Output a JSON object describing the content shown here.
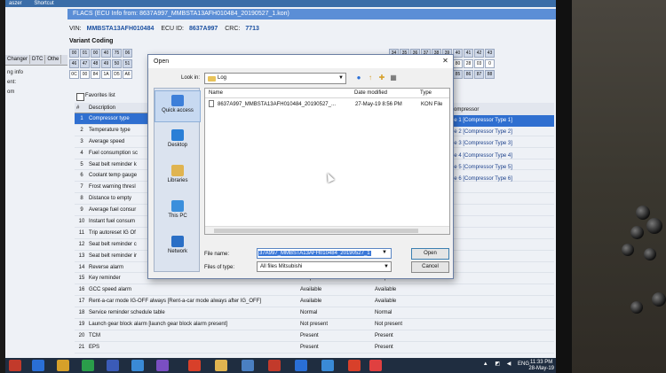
{
  "desktop": {
    "top_items": [
      "aszer",
      "Shortcut"
    ]
  },
  "bg_app": {
    "title": "FLACS (ECU Info from: 8637A997_MMBSTA13AFH010484_20190527_1.kon)",
    "vin_label": "VIN:",
    "vin": "MMBSTA13AFH010484",
    "ecu_label": "ECU ID:",
    "ecu": "8637A997",
    "crc_label": "CRC:",
    "crc": "7713",
    "variant_label": "Variant Coding",
    "left_tabs": [
      "Changer",
      "DTC",
      "Othe"
    ],
    "left_info": [
      "ng info",
      "ent:",
      "om"
    ],
    "hex_row1": [
      "00",
      "01",
      "00",
      "40",
      "75",
      "06"
    ],
    "hex_row2": [
      "46",
      "47",
      "48",
      "49",
      "50",
      "51"
    ],
    "hex_row3": [
      "0C",
      "00",
      "84",
      "1A",
      "D5",
      "A6"
    ],
    "hex_right1": [
      "34",
      "35",
      "36",
      "37",
      "38",
      "39",
      "40",
      "41",
      "42",
      "43"
    ],
    "hex_right2": [
      "43",
      "0C",
      "04",
      "80",
      "00",
      "00",
      "80",
      "28",
      "03",
      "0"
    ],
    "hex_right3": [
      "75",
      "80",
      "81",
      "82",
      "83",
      "84",
      "85",
      "86",
      "87",
      "88"
    ],
    "favorites_label": "Favorites list",
    "col_num": "#",
    "col_desc": "Description",
    "rows": [
      {
        "n": "1",
        "desc": "Compressor type",
        "a": "",
        "b": ""
      },
      {
        "n": "2",
        "desc": "Temperature type",
        "a": "",
        "b": ""
      },
      {
        "n": "3",
        "desc": "Average speed",
        "a": "",
        "b": ""
      },
      {
        "n": "4",
        "desc": "Fuel consumption sc",
        "a": "",
        "b": ""
      },
      {
        "n": "5",
        "desc": "Seat belt reminder k",
        "a": "",
        "b": ""
      },
      {
        "n": "6",
        "desc": "Coolant temp gauge",
        "a": "",
        "b": ""
      },
      {
        "n": "7",
        "desc": "Frost warning thresl",
        "a": "",
        "b": ""
      },
      {
        "n": "8",
        "desc": "Distance to empty",
        "a": "",
        "b": ""
      },
      {
        "n": "9",
        "desc": "Average fuel consur",
        "a": "",
        "b": ""
      },
      {
        "n": "10",
        "desc": "Instant fuel consum",
        "a": "",
        "b": ""
      },
      {
        "n": "11",
        "desc": "Trip autoreset IG Of",
        "a": "",
        "b": ""
      },
      {
        "n": "12",
        "desc": "Seat belt reminder c",
        "a": "",
        "b": ""
      },
      {
        "n": "13",
        "desc": "Seat belt reminder ir",
        "a": "",
        "b": ""
      },
      {
        "n": "14",
        "desc": "Reverse alarm",
        "a": "",
        "b": ""
      },
      {
        "n": "15",
        "desc": "Key reminder",
        "a": "Not present",
        "b": "Not present"
      },
      {
        "n": "16",
        "desc": "GCC speed alarm",
        "a": "Available",
        "b": "Available"
      },
      {
        "n": "17",
        "desc": "Rent-a-car mode IG-OFF always  [Rent-a-car mode always after IG_OFF]",
        "a": "Available",
        "b": "Available"
      },
      {
        "n": "18",
        "desc": "Service reminder schedule table",
        "a": "Normal",
        "b": "Normal"
      },
      {
        "n": "19",
        "desc": "Launch gear block alarm  [launch gear block alarm present]",
        "a": "Not present",
        "b": "Not present"
      },
      {
        "n": "20",
        "desc": "TCM",
        "a": "Present",
        "b": "Present"
      },
      {
        "n": "21",
        "desc": "EPS",
        "a": "Present",
        "b": "Present"
      }
    ],
    "right_header": "compressor",
    "right_items": [
      "pe 1 [Compressor Type 1]",
      "pe 2 [Compressor Type 2]",
      "pe 3 [Compressor Type 3]",
      "pe 4 [Compressor Type 4]",
      "pe 5 [Compressor Type 5]",
      "pe 6 [Compressor Type 6]"
    ]
  },
  "dialog": {
    "title": "Open",
    "close_glyph": "✕",
    "lookin_label": "Look in:",
    "lookin_value": "Log",
    "places": [
      "Quick access",
      "Desktop",
      "Libraries",
      "This PC",
      "Network"
    ],
    "col_name": "Name",
    "col_date": "Date modified",
    "col_type": "Type",
    "files": [
      {
        "name": "8637A997_MMBSTA13AFH010484_20190527_...",
        "date": "27-May-19 8:56 PM",
        "type": "KON File"
      }
    ],
    "filename_label": "File name:",
    "filename_value": "37A997_MMBSTA13AFH010484_20190527_1",
    "filetype_label": "Files of type:",
    "filetype_value": "All files Mitsubishi",
    "open_button": "Open",
    "cancel_button": "Cancel"
  },
  "taskbar": {
    "lang": "ENG",
    "time": "11:33 PM",
    "date": "28-May-19"
  },
  "colors": {
    "selection": "#2f6fd0",
    "title_bar": "#5b8ed6",
    "taskbar": "#1f2d40"
  }
}
